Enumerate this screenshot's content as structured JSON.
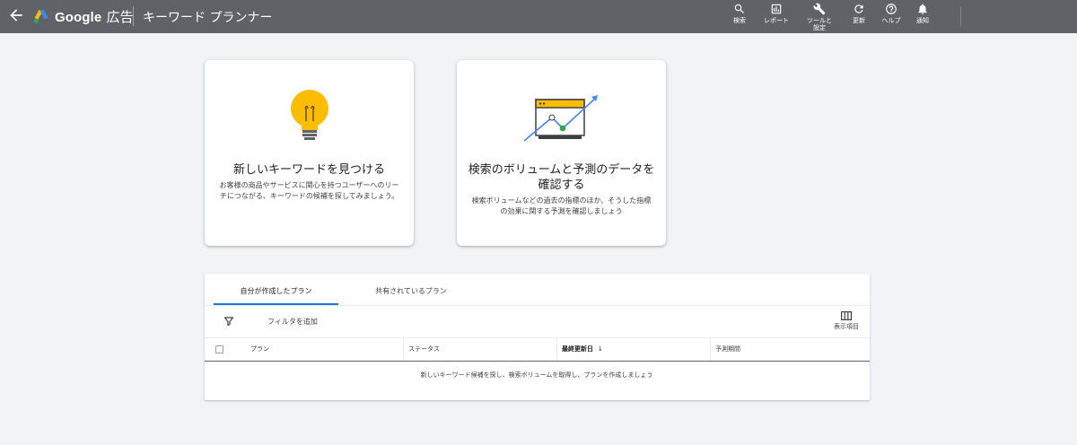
{
  "header": {
    "brand_google": "Google",
    "brand_product": "広告",
    "page_title": "キーワード プランナー",
    "bar_color": "#5f6368",
    "tools": [
      {
        "icon": "search-icon",
        "label": "検索"
      },
      {
        "icon": "report-icon",
        "label": "レポート"
      },
      {
        "icon": "wrench-icon",
        "label": "ツールと\n設定"
      },
      {
        "icon": "refresh-icon",
        "label": "更新"
      },
      {
        "icon": "help-icon",
        "label": "ヘルプ"
      },
      {
        "icon": "bell-icon",
        "label": "通知"
      }
    ]
  },
  "cards": [
    {
      "icon": "lightbulb-icon",
      "title": "新しいキーワードを見つける",
      "description": "お客様の商品やサービスに関心を持つユーザーへのリーチにつながる、キーワードの候補を探してみましょう。"
    },
    {
      "icon": "trend-chart-icon",
      "title": "検索のボリュームと予測のデータを確認する",
      "description": "検索ボリュームなどの過去の指標のほか、そうした指標の効果に関する予測を確認しましょう"
    }
  ],
  "plans": {
    "tabs": [
      {
        "label": "自分が作成したプラン",
        "active": true
      },
      {
        "label": "共有されているプラン",
        "active": false
      }
    ],
    "filter_label": "フィルタを追加",
    "columns_label": "表示項目",
    "table": {
      "columns": [
        "プラン",
        "ステータス",
        "最終更新日",
        "予測期間"
      ],
      "sort_column": "最終更新日",
      "sort_arrow": "↓",
      "empty_message": "新しいキーワード候補を探し、検索ボリュームを取得し、プランを作成しましょう"
    },
    "accent_color": "#1a73e8"
  }
}
